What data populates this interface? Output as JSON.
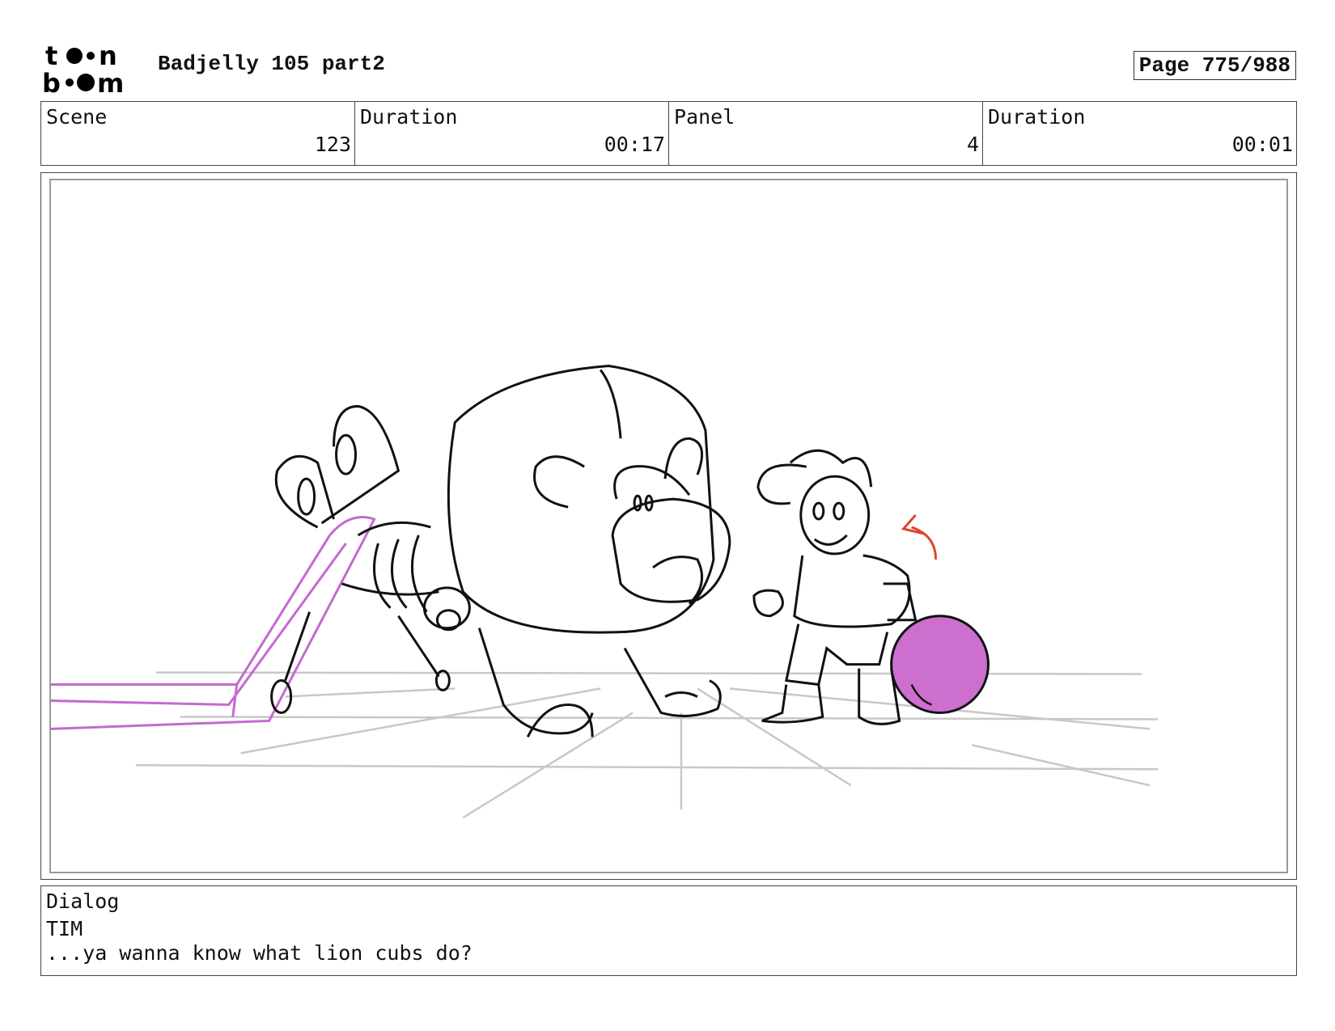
{
  "header": {
    "logo": {
      "icon": "toon-boom-logo",
      "line1": "t",
      "line1b": "n",
      "line2": "b",
      "line2b": "m"
    },
    "title": "Badjelly 105 part2",
    "page": "Page 775/988"
  },
  "info": {
    "scene_label": "Scene",
    "scene_value": "123",
    "scene_duration_label": "Duration",
    "scene_duration_value": "00:17",
    "panel_label": "Panel",
    "panel_value": "4",
    "panel_duration_label": "Duration",
    "panel_duration_value": "00:01"
  },
  "panel": {
    "ink_color": "#111111",
    "guide_color": "#c8c8c8",
    "ribbon_color": "#c46ad0",
    "ball_color": "#cc6fcf",
    "arrow_color": "#e0442a"
  },
  "dialog": {
    "label": "Dialog",
    "speaker": "TIM",
    "line": "...ya wanna know what lion cubs do?"
  }
}
